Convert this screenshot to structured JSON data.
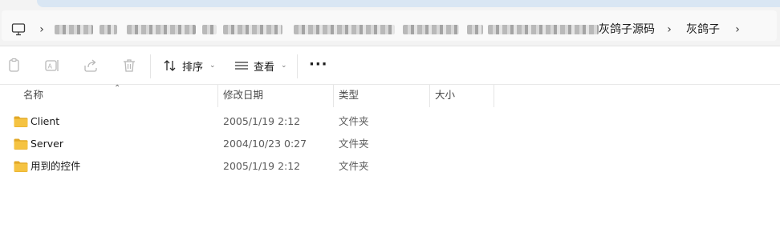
{
  "address": {
    "breadcrumbs": [
      "灰鸽子源码",
      "灰鸽子"
    ],
    "pc_icon": "computer-icon"
  },
  "toolbar": {
    "copy_icon": "copy-icon",
    "rename_icon": "rename-icon",
    "share_icon": "share-icon",
    "delete_icon": "delete-icon",
    "sort_label": "排序",
    "view_label": "查看",
    "more_label": "···"
  },
  "columns": {
    "name": "名称",
    "modified": "修改日期",
    "type": "类型",
    "size": "大小"
  },
  "files": [
    {
      "name": "Client",
      "modified": "2005/1/19 2:12",
      "type": "文件夹",
      "size": ""
    },
    {
      "name": "Server",
      "modified": "2004/10/23 0:27",
      "type": "文件夹",
      "size": ""
    },
    {
      "name": "用到的控件",
      "modified": "2005/1/19 2:12",
      "type": "文件夹",
      "size": ""
    }
  ],
  "colors": {
    "folder": "#f5c342",
    "folder_dark": "#e2a826",
    "accent": "#d9e6f3"
  }
}
